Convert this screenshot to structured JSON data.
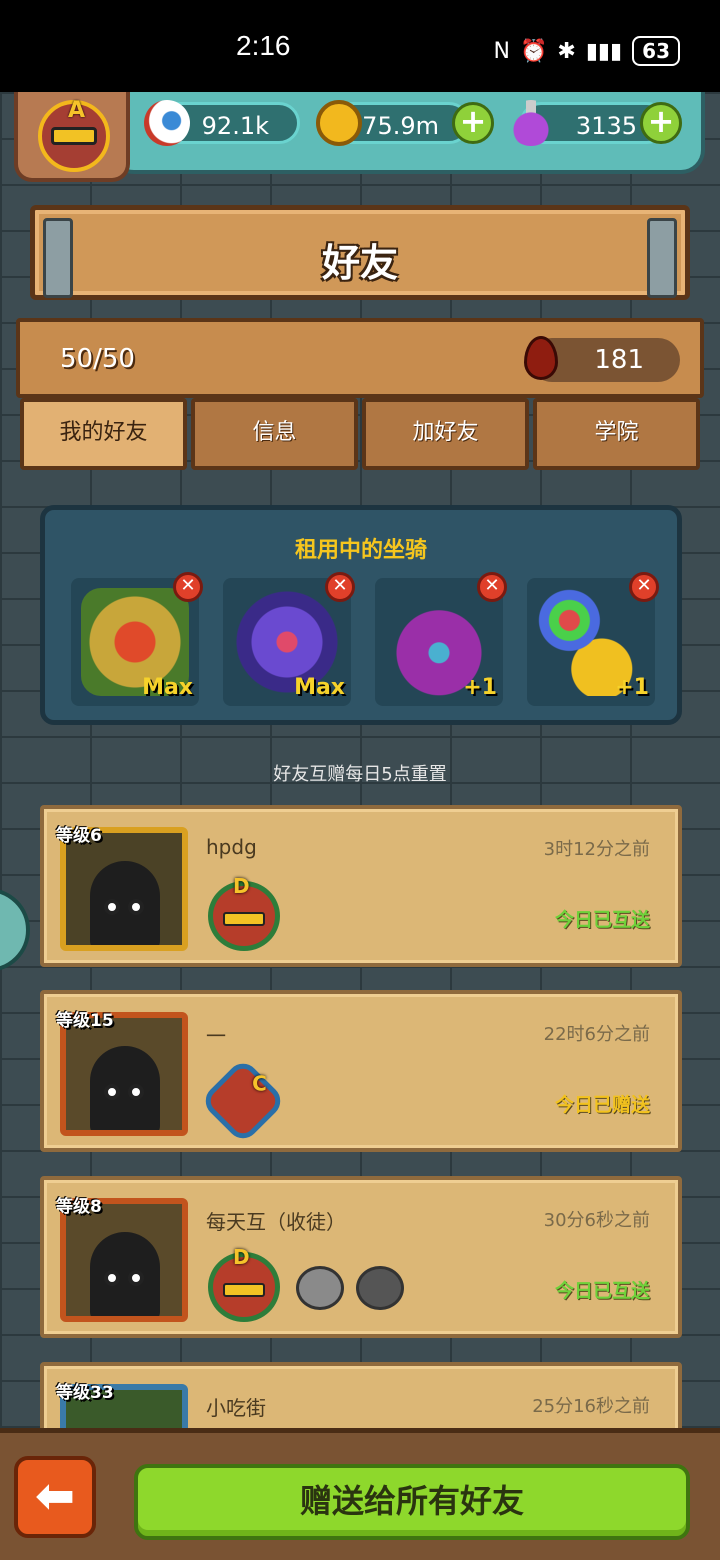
{
  "status": {
    "time": "2:16",
    "battery": "63"
  },
  "resources": {
    "eyes": "92.1k",
    "coins": "375.9m",
    "potions": "3135"
  },
  "avatar_rank": "A",
  "header": {
    "title": "好友"
  },
  "friends_count": "50/50",
  "blood": "181",
  "tabs": [
    "我的好友",
    "信息",
    "加好友",
    "学院"
  ],
  "mounts": {
    "title": "租用中的坐骑",
    "items": [
      {
        "level": "Max",
        "icon": "lion-dance-icon",
        "color": "#c8a63a"
      },
      {
        "level": "Max",
        "icon": "rose-icon",
        "color": "#5a3aa8"
      },
      {
        "level": "+1",
        "icon": "horned-monster-icon",
        "color": "#8a2f9a"
      },
      {
        "level": "+1",
        "icon": "balloon-ship-icon",
        "color": "#e0b51e"
      }
    ]
  },
  "reset_note": "好友互赠每日5点重置",
  "friends": [
    {
      "level": "等级6",
      "name": "hpdg",
      "time": "3时12分之前",
      "state": "今日已互送",
      "state_color": "#6ed13a",
      "rank": "D"
    },
    {
      "level": "等级15",
      "name": "一",
      "time": "22时6分之前",
      "state": "今日已赠送",
      "state_color": "#f2c21e",
      "rank": "C"
    },
    {
      "level": "等级8",
      "name": "每天互（收徒）",
      "time": "30分6秒之前",
      "state": "今日已互送",
      "state_color": "#6ed13a",
      "rank": "D"
    },
    {
      "level": "等级33",
      "name": "小吃街",
      "time": "25分16秒之前",
      "state": "",
      "state_color": "#6ed13a",
      "rank": ""
    }
  ],
  "bottom": {
    "gift_all": "赠送给所有好友"
  }
}
